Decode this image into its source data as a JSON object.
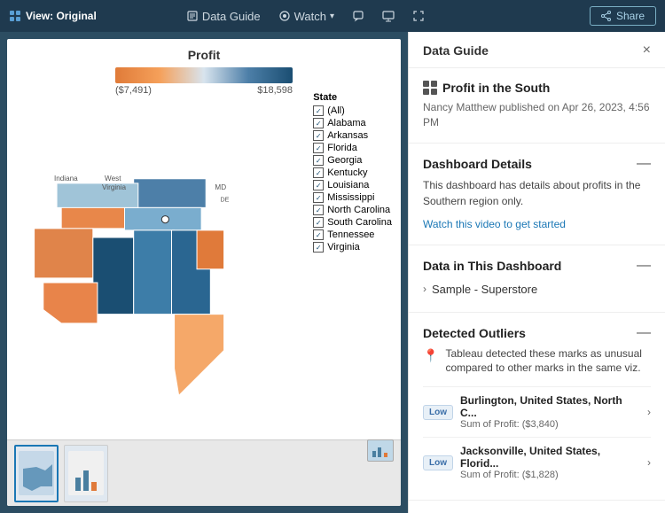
{
  "topbar": {
    "logo_text": "View: Original",
    "data_guide_label": "Data Guide",
    "watch_label": "Watch",
    "share_label": "Share",
    "icons": {
      "logo": "▦",
      "data_guide": "📋",
      "watch": "👁",
      "comment": "💬",
      "present": "📺",
      "fullscreen": "⛶"
    }
  },
  "panel": {
    "title": "Data Guide",
    "close": "×",
    "viz_title": "Profit in the South",
    "published": "Nancy Matthew published on Apr 26, 2023, 4:56 PM",
    "dashboard_details_title": "Dashboard Details",
    "dashboard_details_text": "This dashboard has details about profits in the Southern region only.",
    "watch_link": "Watch this video to get started",
    "data_section_title": "Data in This Dashboard",
    "data_item": "Sample - Superstore",
    "outliers_title": "Detected Outliers",
    "outlier_desc": "Tableau detected these marks as unusual compared to other marks in the same viz.",
    "outlier1": {
      "badge": "Low",
      "name": "Burlington, United States, North C...",
      "value": "Sum of Profit: ($3,840)"
    },
    "outlier2": {
      "badge": "Low",
      "name": "Jacksonville, United States, Florid...",
      "value": "Sum of Profit: ($1,828)"
    }
  },
  "chart": {
    "title": "Profit",
    "min_label": "($7,491)",
    "max_label": "$18,598",
    "states_title": "State",
    "states": [
      "(All)",
      "Alabama",
      "Arkansas",
      "Florida",
      "Georgia",
      "Kentucky",
      "Louisiana",
      "Mississippi",
      "North Carolina",
      "South Carolina",
      "Tennessee",
      "Virginia"
    ]
  }
}
